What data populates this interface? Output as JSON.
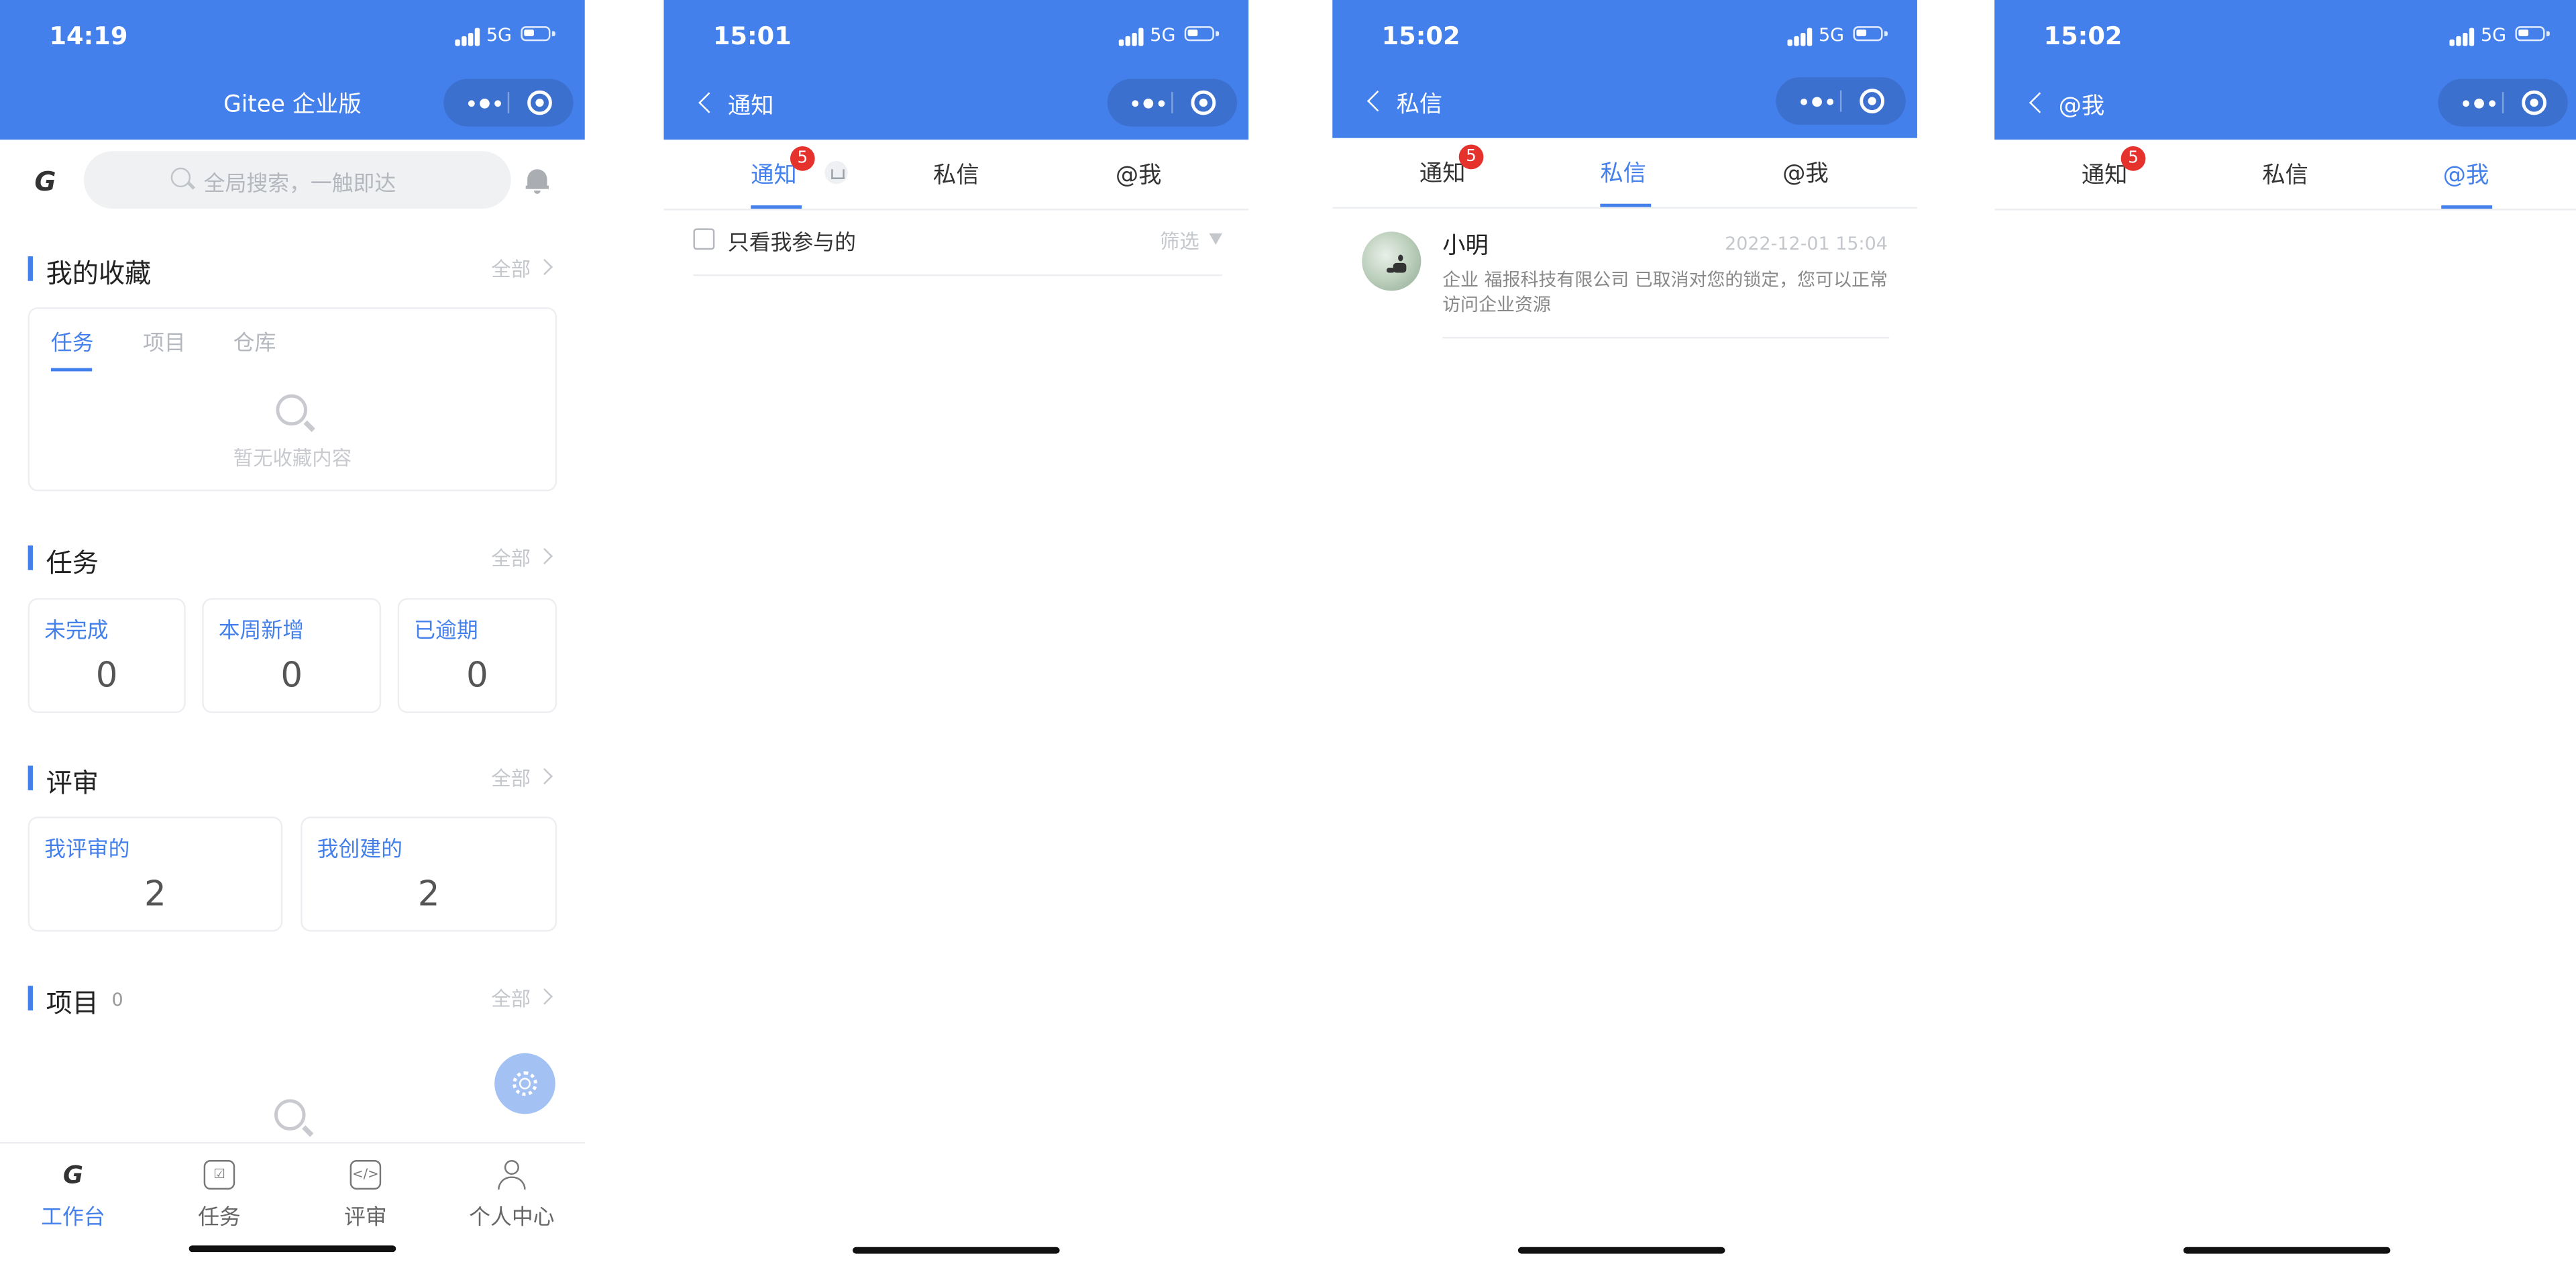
{
  "status_bar": {
    "network": "5G"
  },
  "screen1": {
    "time": "14:19",
    "nav_title": "Gitee 企业版",
    "logo": "G",
    "search_placeholder": "全局搜索，一触即达",
    "favorites": {
      "title": "我的收藏",
      "all": "全部",
      "tabs": [
        "任务",
        "项目",
        "仓库"
      ],
      "active_tab": 0,
      "empty_text": "暂无收藏内容"
    },
    "tasks": {
      "title": "任务",
      "all": "全部",
      "stats": [
        {
          "label": "未完成",
          "value": "0"
        },
        {
          "label": "本周新增",
          "value": "0"
        },
        {
          "label": "已逾期",
          "value": "0"
        }
      ]
    },
    "reviews": {
      "title": "评审",
      "all": "全部",
      "stats": [
        {
          "label": "我评审的",
          "value": "2"
        },
        {
          "label": "我创建的",
          "value": "2"
        }
      ]
    },
    "projects": {
      "title": "项目",
      "count": "0",
      "all": "全部"
    },
    "tabbar": [
      {
        "label": "工作台",
        "icon": "gitee-logo-icon",
        "active": true
      },
      {
        "label": "任务",
        "icon": "task-list-icon"
      },
      {
        "label": "评审",
        "icon": "code-review-icon"
      },
      {
        "label": "个人中心",
        "icon": "user-icon"
      }
    ]
  },
  "screen2": {
    "time": "15:01",
    "back_title": "通知",
    "tabs": [
      "通知",
      "私信",
      "@我"
    ],
    "active_tab": 0,
    "badge": "5",
    "checkbox_label": "只看我参与的",
    "filter_label": "筛选"
  },
  "screen3": {
    "time": "15:02",
    "back_title": "私信",
    "tabs": [
      "通知",
      "私信",
      "@我"
    ],
    "active_tab": 1,
    "badge": "5",
    "message": {
      "sender": "小明",
      "time": "2022-12-01 15:04",
      "body": "企业 福报科技有限公司 已取消对您的锁定，您可以正常访问企业资源"
    }
  },
  "screen4": {
    "time": "15:02",
    "back_title": "@我",
    "tabs": [
      "通知",
      "私信",
      "@我"
    ],
    "active_tab": 2,
    "badge": "5"
  },
  "colors": {
    "brand_blue": "#4480ec",
    "badge_red": "#e5322d",
    "fab": "#a4c1f4"
  }
}
